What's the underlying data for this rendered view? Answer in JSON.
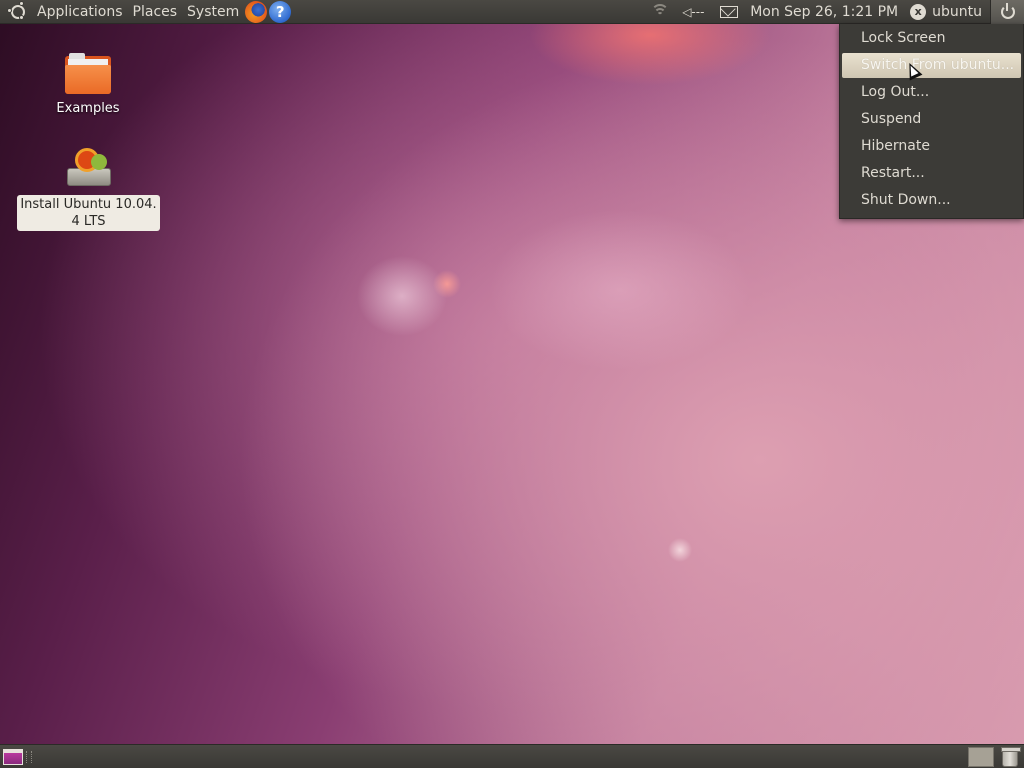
{
  "top_panel": {
    "menus": {
      "applications": "Applications",
      "places": "Places",
      "system": "System"
    },
    "launchers": {
      "firefox_icon": "firefox-icon",
      "help_icon_glyph": "?"
    },
    "tray": {
      "datetime": "Mon Sep 26,  1:21 PM",
      "user_status_glyph": "x",
      "username": "ubuntu",
      "sound_glyph": "◁---"
    }
  },
  "session_menu": {
    "items": [
      {
        "label": "Lock Screen"
      },
      {
        "label": "Switch From ubuntu..."
      },
      {
        "label": "Log Out..."
      },
      {
        "label": "Suspend"
      },
      {
        "label": "Hibernate"
      },
      {
        "label": "Restart..."
      },
      {
        "label": "Shut Down..."
      }
    ],
    "highlighted_index": 1
  },
  "desktop": {
    "icons": [
      {
        "label": "Examples",
        "icon": "folder-icon"
      },
      {
        "label_line1": "Install Ubuntu 10.04.",
        "label_line2": "4 LTS",
        "icon": "install-drive-icon"
      }
    ]
  },
  "bottom_panel": {
    "show_desktop_icon": "show-desktop-icon",
    "workspace_icon": "workspace-switcher",
    "trash_icon": "trash-icon"
  },
  "colors": {
    "panel": "#3c3b37",
    "menu_highlight": "#e0d8c6",
    "panel_text": "#dfdbd2",
    "wallpaper_accent": "#8a3e72"
  }
}
